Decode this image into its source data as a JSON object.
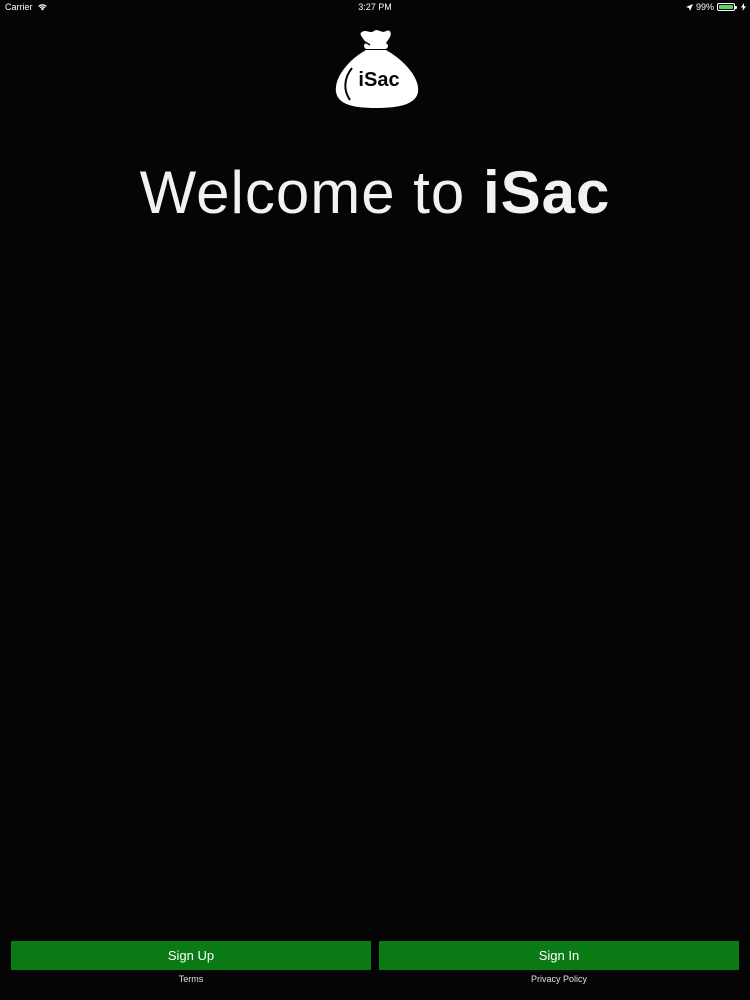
{
  "status_bar": {
    "carrier": "Carrier",
    "time": "3:27 PM",
    "battery_percent": "99%",
    "battery_level": 0.99
  },
  "logo": {
    "text": "iSac",
    "icon": "money-bag-icon"
  },
  "title": {
    "prefix": "Welcome to ",
    "brand": "iSac"
  },
  "actions": {
    "sign_up_label": "Sign Up",
    "sign_in_label": "Sign In",
    "terms_label": "Terms",
    "privacy_label": "Privacy Policy"
  },
  "colors": {
    "background": "#050505",
    "button": "#0a7a14",
    "battery": "#4cd964"
  }
}
